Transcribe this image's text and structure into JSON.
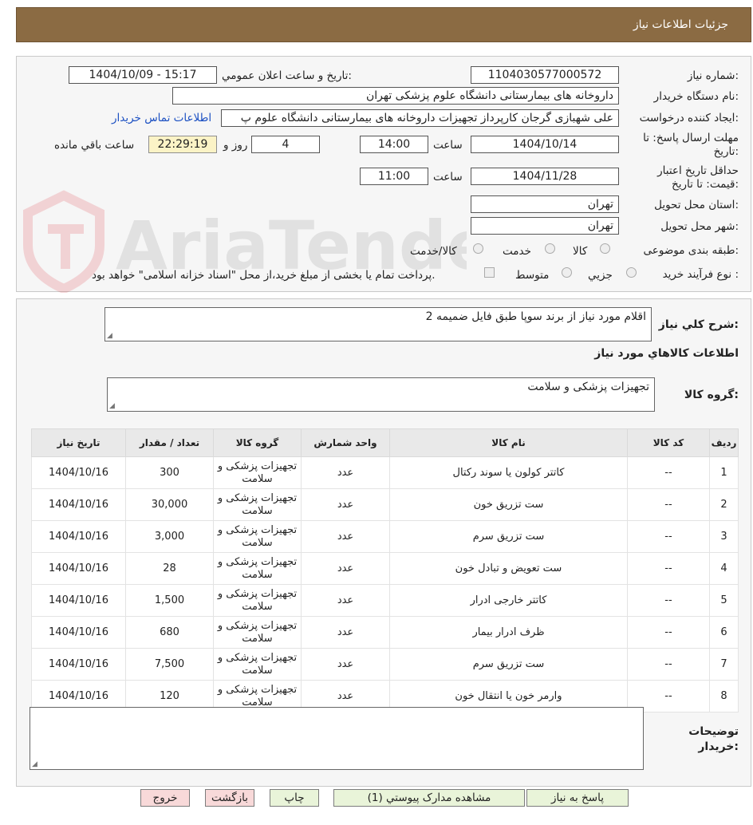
{
  "header": {
    "title": "جزئیات اطلاعات نیاز"
  },
  "watermark": {
    "text": "AriaTender.neT"
  },
  "form": {
    "need_number_label": "شماره نیاز:",
    "need_number": "1104030577000572",
    "announce_label": "تاریخ و ساعت اعلان عمومي:",
    "announce_value": "1404/10/09 - 15:17",
    "buyer_org_label": "نام دستگاه خريدار:",
    "buyer_org": "داروخانه های بیمارستانی دانشگاه علوم پزشکی تهران",
    "requester_label": "ايجاد کننده درخواست:",
    "requester": "علی شهبازی گرجان کارپرداز تجهیزات داروخانه های بیمارستانی دانشگاه علوم پ",
    "contact_link": "اطلاعات تماس خريدار",
    "deadline_label_1": "مهلت ارسال پاسخ: تا",
    "deadline_label_2": "تاریخ:",
    "deadline_date": "1404/10/14",
    "time_label": "ساعت",
    "deadline_time": "14:00",
    "days_value": "4",
    "days_label": "روز و",
    "remaining_time": "22:29:19",
    "remaining_label": "ساعت باقي مانده",
    "validity_label_1": "حداقل تاريخ اعتبار",
    "validity_label_2": "قيمت: تا تاريخ:",
    "validity_date": "1404/11/28",
    "validity_time": "11:00",
    "province_label": "استان محل تحويل:",
    "province": "تهران",
    "city_label": "شهر محل تحويل:",
    "city": "تهران",
    "category_label": "طبقه بندی موضوعی:",
    "category_options": [
      "کالا",
      "خدمت",
      "کالا/خدمت"
    ],
    "process_label": "نوع فرآيند خريد :",
    "process_options": [
      "جزيي",
      "متوسط"
    ],
    "payment_note": "پرداخت تمام يا بخشی از مبلغ خريد،از محل \"اسناد خزانه اسلامی\" خواهد بود."
  },
  "summary": {
    "description_label": "شرح کلي نياز:",
    "description": "اقلام مورد نیاز از برند سوپا طبق فایل ضمیمه 2",
    "goods_info_title": "اطلاعات کالاهاي مورد نياز",
    "goods_group_label": "گروه کالا:",
    "goods_group": "تجهیزات پزشکی و سلامت"
  },
  "table": {
    "headers": [
      "رديف",
      "کد کالا",
      "نام کالا",
      "واحد شمارش",
      "گروه کالا",
      "تعداد / مقدار",
      "تاریخ نیاز"
    ],
    "rows": [
      [
        "1",
        "--",
        "کاتتر کولون یا سوند رکتال",
        "عدد",
        "تجهیزات پزشکی و سلامت",
        "300",
        "1404/10/16"
      ],
      [
        "2",
        "--",
        "ست تزریق خون",
        "عدد",
        "تجهیزات پزشکی و سلامت",
        "30,000",
        "1404/10/16"
      ],
      [
        "3",
        "--",
        "ست تزریق سرم",
        "عدد",
        "تجهیزات پزشکی و سلامت",
        "3,000",
        "1404/10/16"
      ],
      [
        "4",
        "--",
        "ست تعویض و تبادل خون",
        "عدد",
        "تجهیزات پزشکی و سلامت",
        "28",
        "1404/10/16"
      ],
      [
        "5",
        "--",
        "کاتتر خارجی ادرار",
        "عدد",
        "تجهیزات پزشکی و سلامت",
        "1,500",
        "1404/10/16"
      ],
      [
        "6",
        "--",
        "ظرف ادرار بیمار",
        "عدد",
        "تجهیزات پزشکی و سلامت",
        "680",
        "1404/10/16"
      ],
      [
        "7",
        "--",
        "ست تزریق سرم",
        "عدد",
        "تجهیزات پزشکی و سلامت",
        "7,500",
        "1404/10/16"
      ],
      [
        "8",
        "--",
        "وارمر خون یا انتقال خون",
        "عدد",
        "تجهیزات پزشکی و سلامت",
        "120",
        "1404/10/16"
      ]
    ]
  },
  "notes": {
    "label_1": "توضیحات",
    "label_2": "خريدار:"
  },
  "buttons": {
    "reply": "پاسخ به نیاز",
    "attachments": "مشاهده مدارک پیوستي (1)",
    "print": "چاپ",
    "back": "بازگشت",
    "exit": "خروج"
  },
  "colors": {
    "header_bg": "#8b6b43",
    "button_green": "#e9f4d9",
    "button_red": "#f8d9d9",
    "remaining_bg": "#fbf3c6"
  }
}
